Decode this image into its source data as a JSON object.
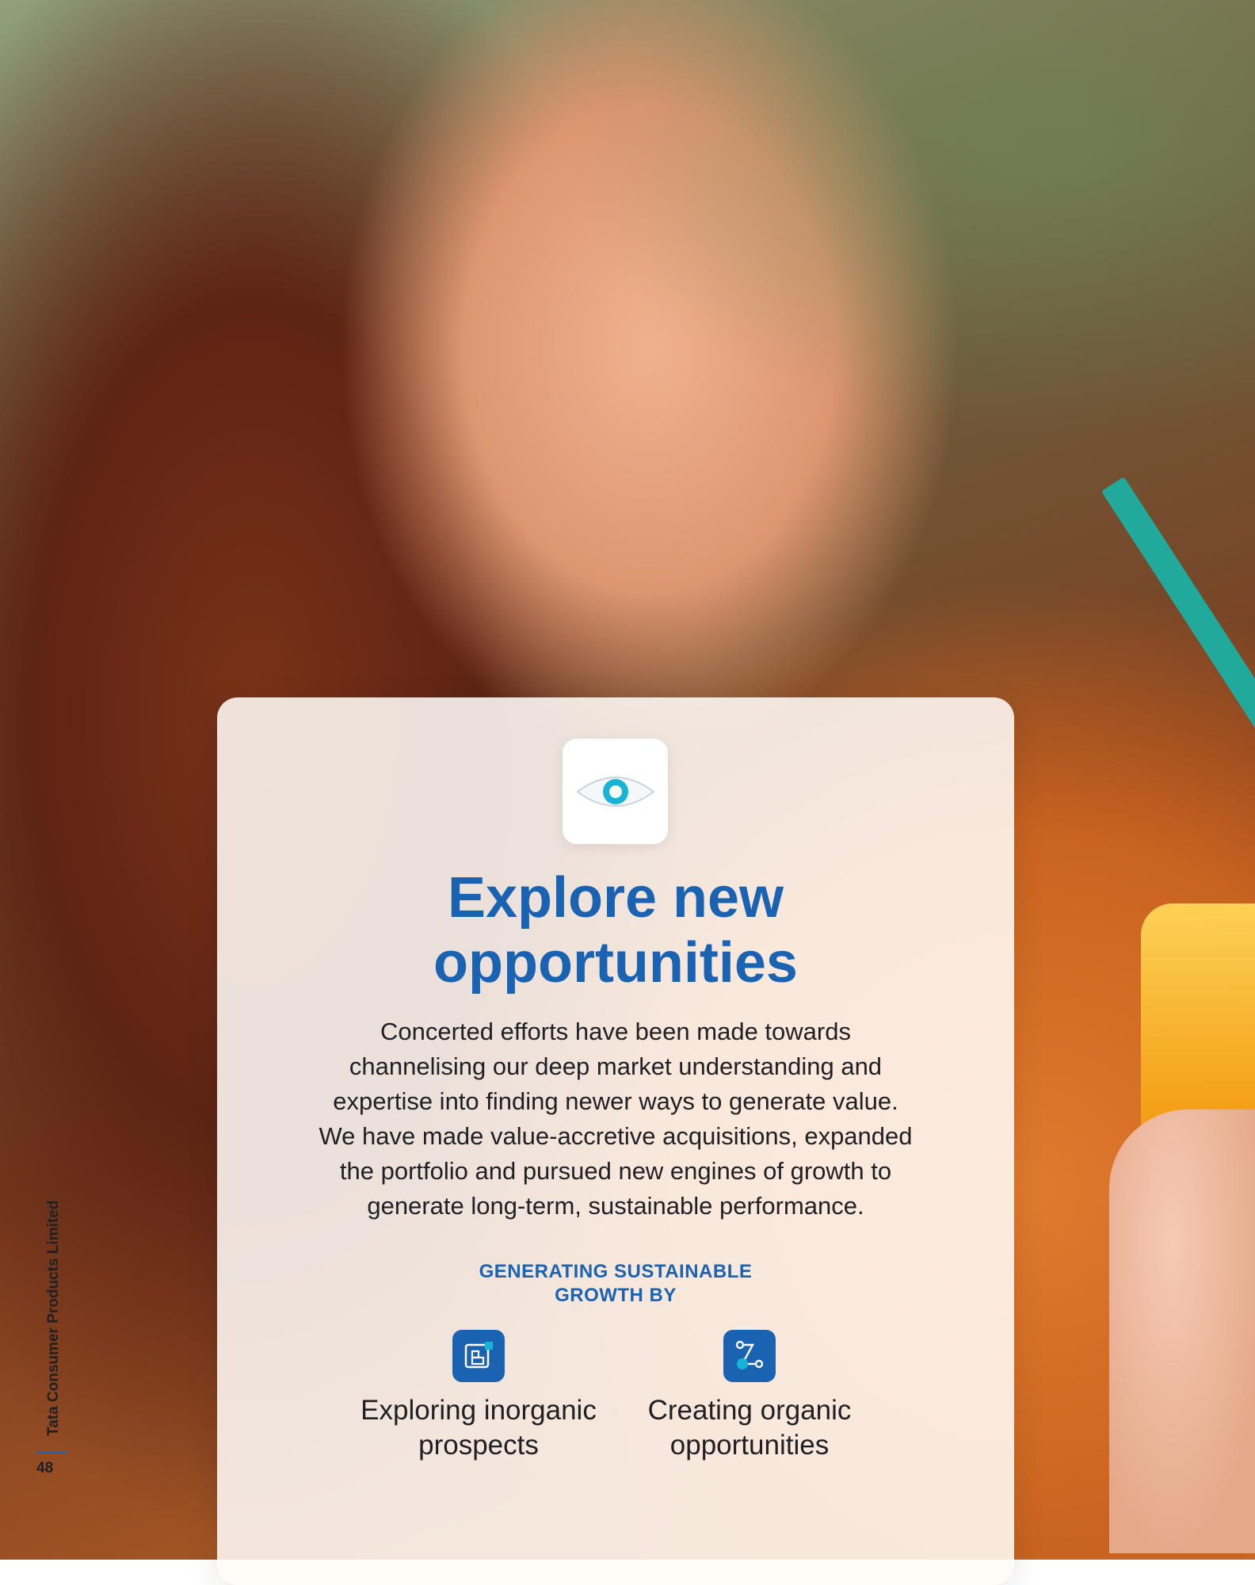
{
  "card": {
    "title_line1": "Explore new",
    "title_line2": "opportunities",
    "body_lines": [
      "Concerted efforts have been made towards",
      "channelising our deep market understanding and",
      "expertise into finding newer ways to generate value.",
      "We have made value-accretive acquisitions, expanded",
      "the portfolio and pursued new engines of growth to",
      "generate long-term, sustainable performance."
    ],
    "subhead_line1": "GENERATING SUSTAINABLE",
    "subhead_line2": "GROWTH BY",
    "items": [
      {
        "icon": "inorganic-blocks-icon",
        "label_line1": "Exploring inorganic",
        "label_line2": "prospects"
      },
      {
        "icon": "organic-nodes-icon",
        "label_line1": "Creating organic",
        "label_line2": "opportunities"
      }
    ],
    "header_icon": "eye-icon"
  },
  "footer": {
    "company": "Tata Consumer Products Limited",
    "page_number": "48"
  },
  "colors": {
    "brand_blue": "#1a63b3",
    "eye_accent": "#17b4d6",
    "text": "#1f1f24"
  }
}
